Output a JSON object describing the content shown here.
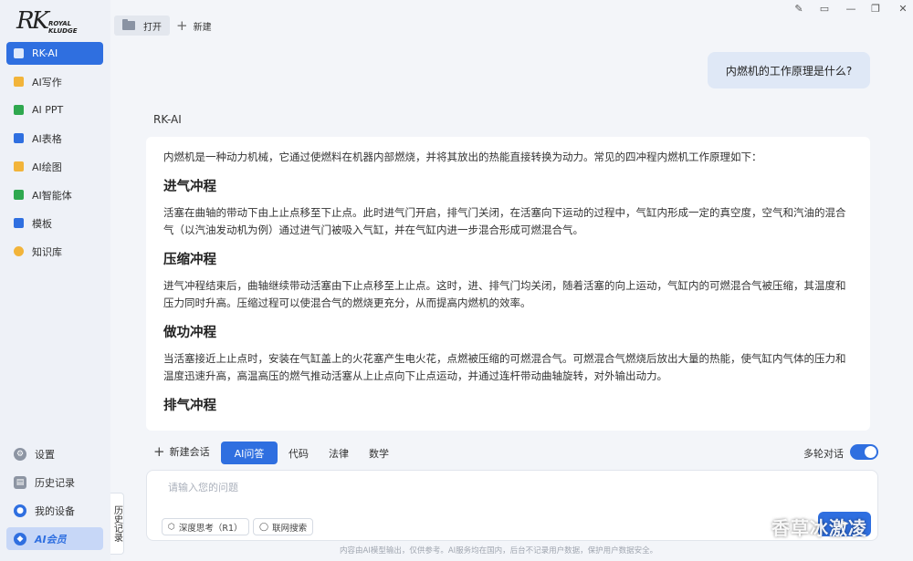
{
  "brand": {
    "logo_mark": "RK",
    "logo_sub_line1": "ROYAL",
    "logo_sub_line2": "KLUDGE"
  },
  "sidebar": {
    "items": [
      {
        "label": "RK-AI",
        "icon": "rk-ai-icon",
        "color": "#ffffff",
        "active": true
      },
      {
        "label": "AI写作",
        "icon": "writing-icon",
        "color": "#f2b43a"
      },
      {
        "label": "AI PPT",
        "icon": "ppt-icon",
        "color": "#2fa84f"
      },
      {
        "label": "AI表格",
        "icon": "table-icon",
        "color": "#2f6fe0"
      },
      {
        "label": "AI绘图",
        "icon": "drawing-icon",
        "color": "#f2b43a"
      },
      {
        "label": "AI智能体",
        "icon": "agent-icon",
        "color": "#2fa84f"
      },
      {
        "label": "模板",
        "icon": "template-icon",
        "color": "#2f6fe0"
      },
      {
        "label": "知识库",
        "icon": "knowledge-icon",
        "color": "#f2b43a"
      }
    ],
    "bottom": [
      {
        "label": "设置",
        "icon": "gear-icon"
      },
      {
        "label": "历史记录",
        "icon": "history-icon"
      },
      {
        "label": "我的设备",
        "icon": "device-icon"
      },
      {
        "label": "AI会员",
        "icon": "vip-icon"
      }
    ],
    "history_tab": "历史记录"
  },
  "topbar": {
    "open_label": "打开",
    "new_label": "新建"
  },
  "chat": {
    "user_question": "内燃机的工作原理是什么?",
    "bot_name": "RK-AI",
    "intro": "内燃机是一种动力机械，它通过使燃料在机器内部燃烧，并将其放出的热能直接转换为动力。常见的四冲程内燃机工作原理如下：",
    "sections": [
      {
        "heading": "进气冲程",
        "body": "活塞在曲轴的带动下由上止点移至下止点。此时进气门开启，排气门关闭，在活塞向下运动的过程中，气缸内形成一定的真空度，空气和汽油的混合气（以汽油发动机为例）通过进气门被吸入气缸，并在气缸内进一步混合形成可燃混合气。"
      },
      {
        "heading": "压缩冲程",
        "body": "进气冲程结束后，曲轴继续带动活塞由下止点移至上止点。这时，进、排气门均关闭，随着活塞的向上运动，气缸内的可燃混合气被压缩，其温度和压力同时升高。压缩过程可以使混合气的燃烧更充分，从而提高内燃机的效率。"
      },
      {
        "heading": "做功冲程",
        "body": "当活塞接近上止点时，安装在气缸盖上的火花塞产生电火花，点燃被压缩的可燃混合气。可燃混合气燃烧后放出大量的热能，使气缸内气体的压力和温度迅速升高，高温高压的燃气推动活塞从上止点向下止点运动，并通过连杆带动曲轴旋转，对外输出动力。"
      },
      {
        "heading": "排气冲程",
        "body": ""
      }
    ]
  },
  "tools": {
    "new_chat": "新建会话",
    "modes": [
      "AI问答",
      "代码",
      "法律",
      "数学"
    ],
    "active_mode": "AI问答",
    "multi_turn_label": "多轮对话",
    "multi_turn_on": true
  },
  "input": {
    "placeholder": "请输入您的问题",
    "deep_think": "深度思考（R1）",
    "web_search": "联网搜索"
  },
  "disclaimer": "内容由AI模型输出，仅供参考。AI服务均在国内，后台不记录用户数据，保护用户数据安全。",
  "watermark": "香草冰激凌",
  "accent_color": "#2f6fe0"
}
